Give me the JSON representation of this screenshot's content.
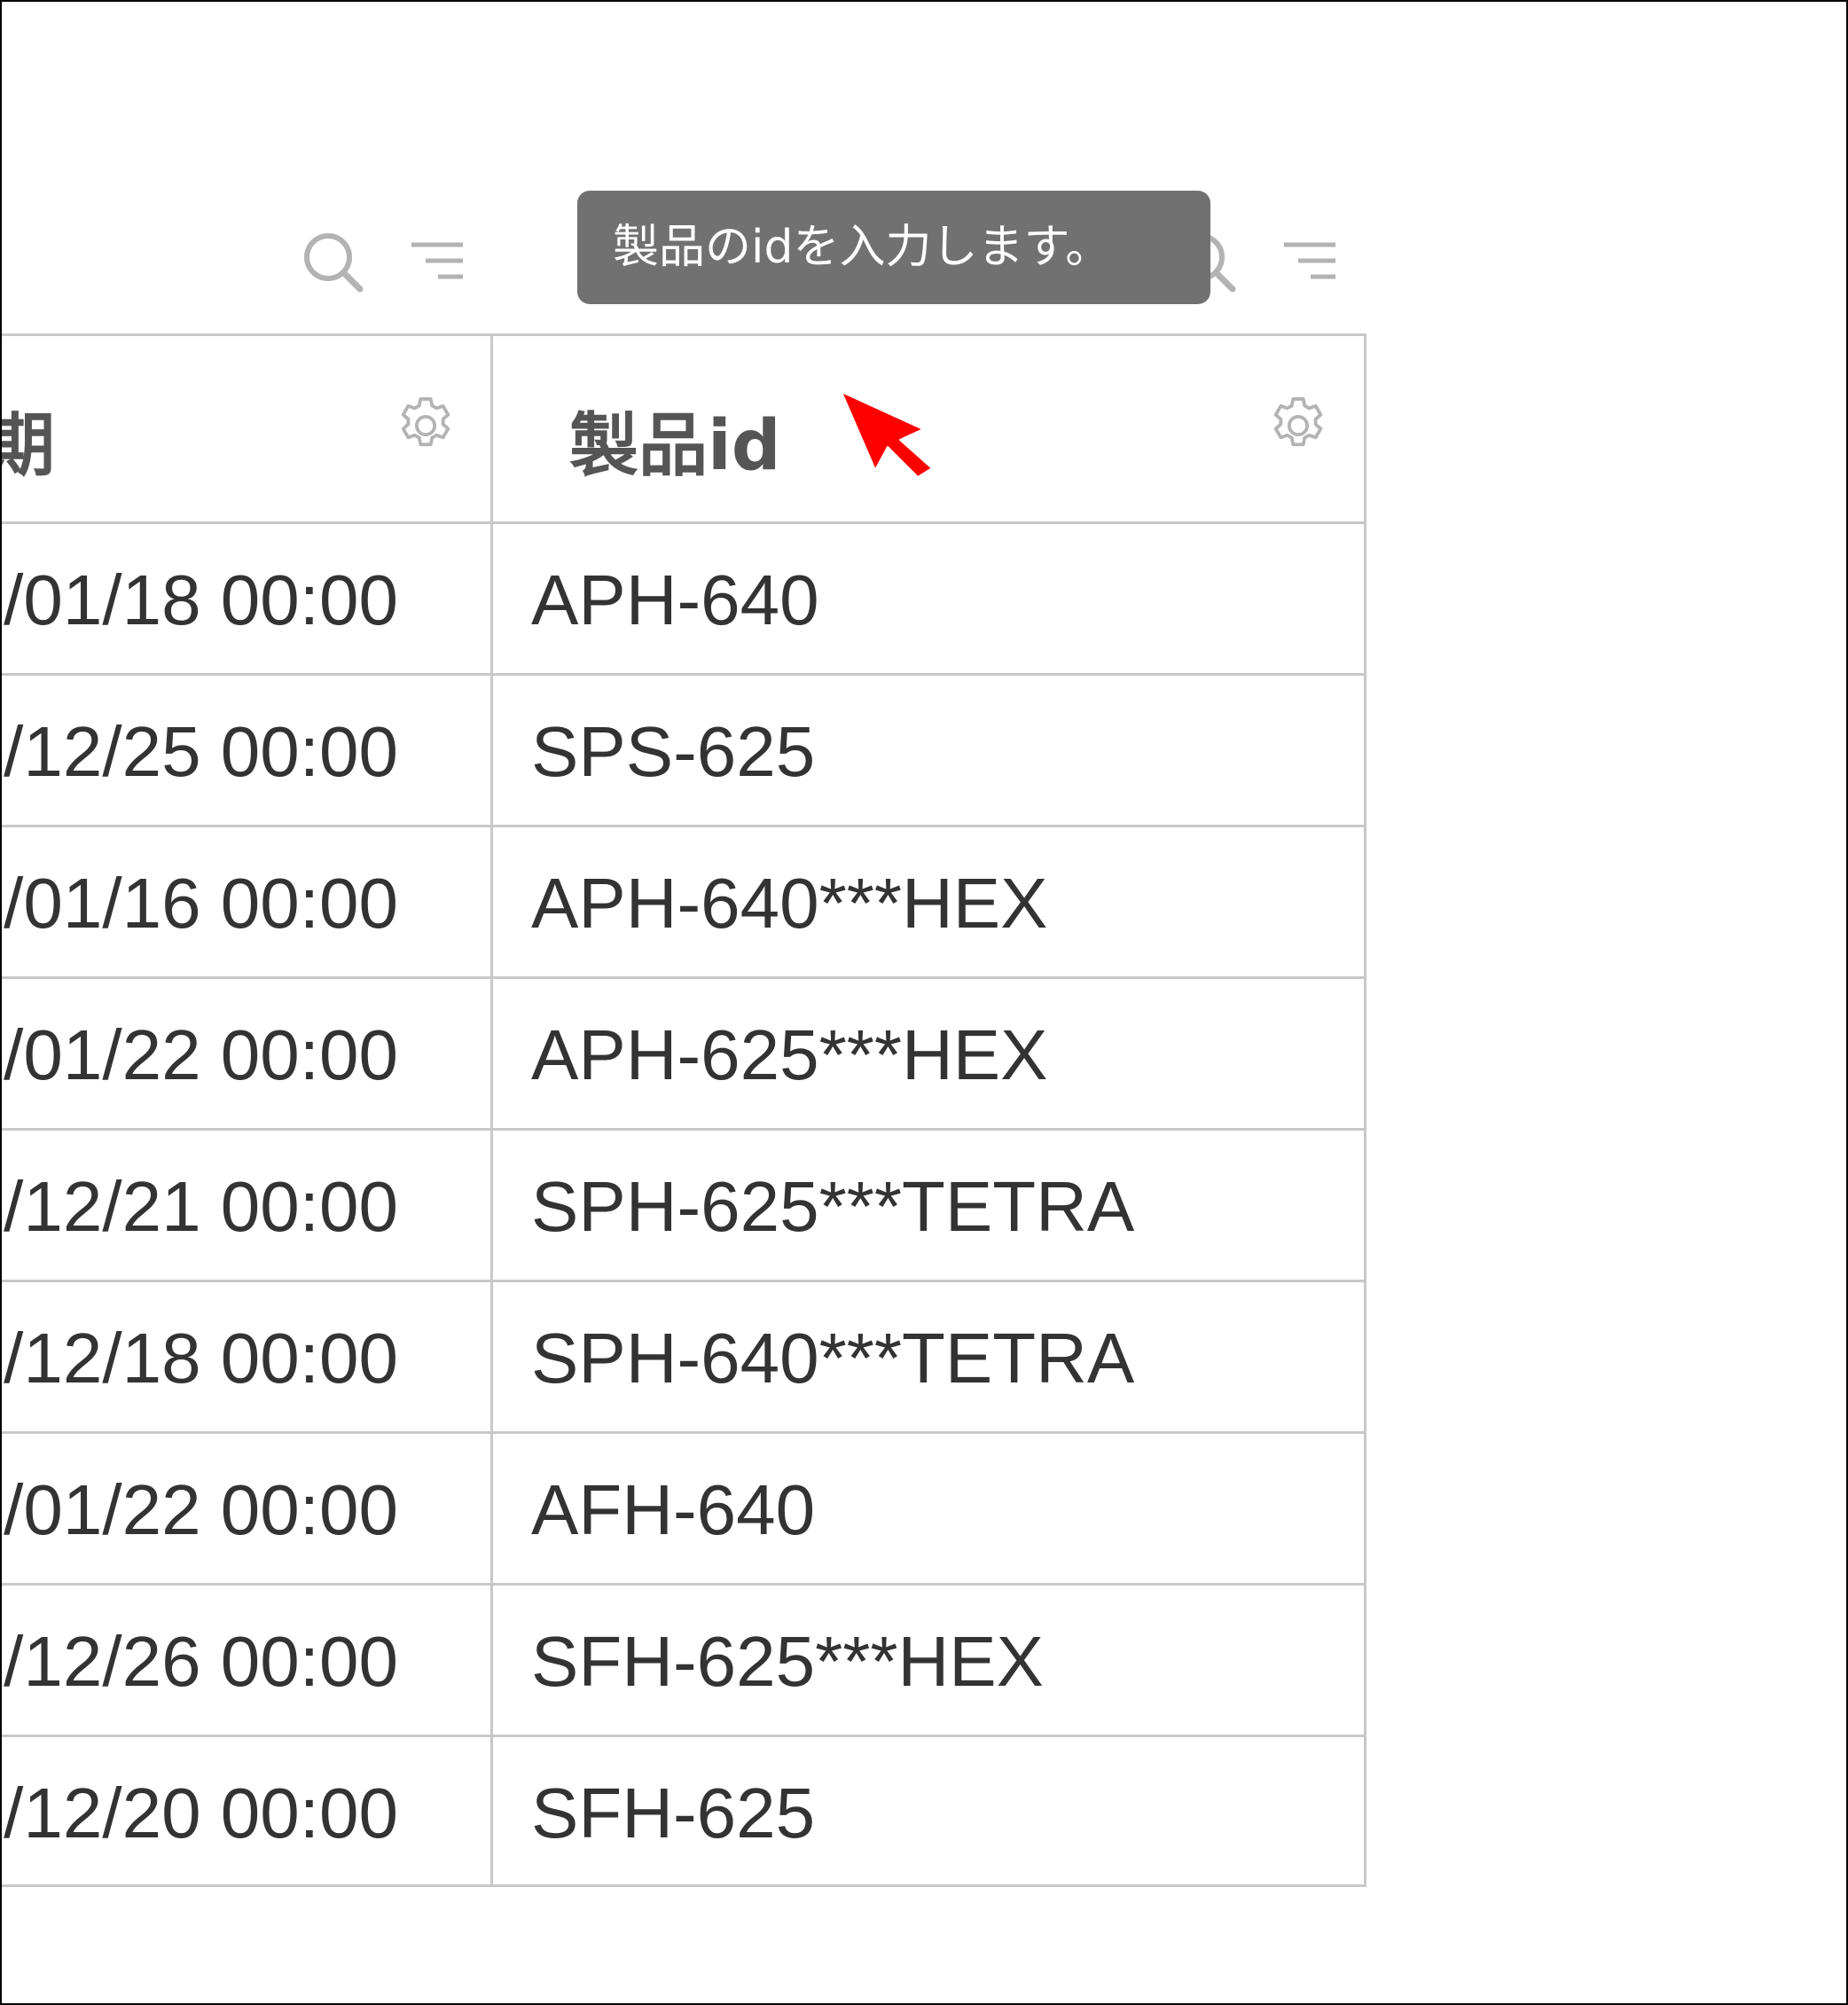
{
  "toolbar": {
    "left_column_icons": [
      "search-icon",
      "filter-icon"
    ],
    "right_column_icons": [
      "search-icon",
      "filter-icon"
    ]
  },
  "tooltip": {
    "text": "製品のidを入力します。"
  },
  "table": {
    "columns": [
      {
        "label": "期",
        "icon": "gear-icon"
      },
      {
        "label": "製品id",
        "icon": "gear-icon"
      }
    ],
    "rows": [
      {
        "date": "/01/18 00:00",
        "product_id": "APH-640"
      },
      {
        "date": "/12/25 00:00",
        "product_id": "SPS-625"
      },
      {
        "date": "/01/16 00:00",
        "product_id": "APH-640***HEX"
      },
      {
        "date": "/01/22 00:00",
        "product_id": "APH-625***HEX"
      },
      {
        "date": "/12/21 00:00",
        "product_id": "SPH-625***TETRA"
      },
      {
        "date": "/12/18 00:00",
        "product_id": "SPH-640***TETRA"
      },
      {
        "date": "/01/22 00:00",
        "product_id": "AFH-640"
      },
      {
        "date": "/12/26 00:00",
        "product_id": "SFH-625***HEX"
      },
      {
        "date": "/12/20 00:00",
        "product_id": "SFH-625"
      }
    ]
  },
  "colors": {
    "tooltip_bg": "#717171",
    "grid_line": "#c8c8c8",
    "icon_gray": "#b3b3b3",
    "cursor": "#ff0000"
  }
}
